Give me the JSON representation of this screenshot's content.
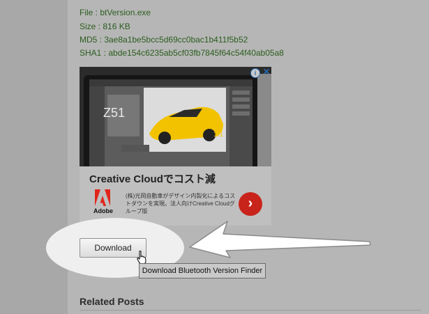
{
  "file_info": {
    "file_line": "File : btVersion.exe",
    "size_line": "Size : 816 KB",
    "md5_line": "MD5 : 3ae8a1be5bcc5d69cc0bac1b411f5b52",
    "sha1_line": "SHA1 : abde154c6235ab5cf03fb7845f64c54f40ab05a8"
  },
  "ad": {
    "headline": "Creative Cloudでコスト減",
    "body": "(株)光岡自動車がデザイン内製化によるコストダウンを実現。法人向けCreative Cloudグループ版",
    "logo_text": "Adobe",
    "cta_symbol": "›",
    "info_symbol": "i",
    "close_symbol": "✕",
    "photo_labels": {
      "big_number": "Z51",
      "small_number": "1.1"
    }
  },
  "download": {
    "button_label": "Download",
    "tooltip": "Download Bluetooth Version Finder"
  },
  "related": {
    "heading": "Related Posts"
  },
  "colors": {
    "info_text": "#2b5d1e",
    "overlay": "#b6b6b6",
    "cta": "#c8241b",
    "adobe_red": "#e1251b",
    "car_yellow": "#f2c200"
  }
}
